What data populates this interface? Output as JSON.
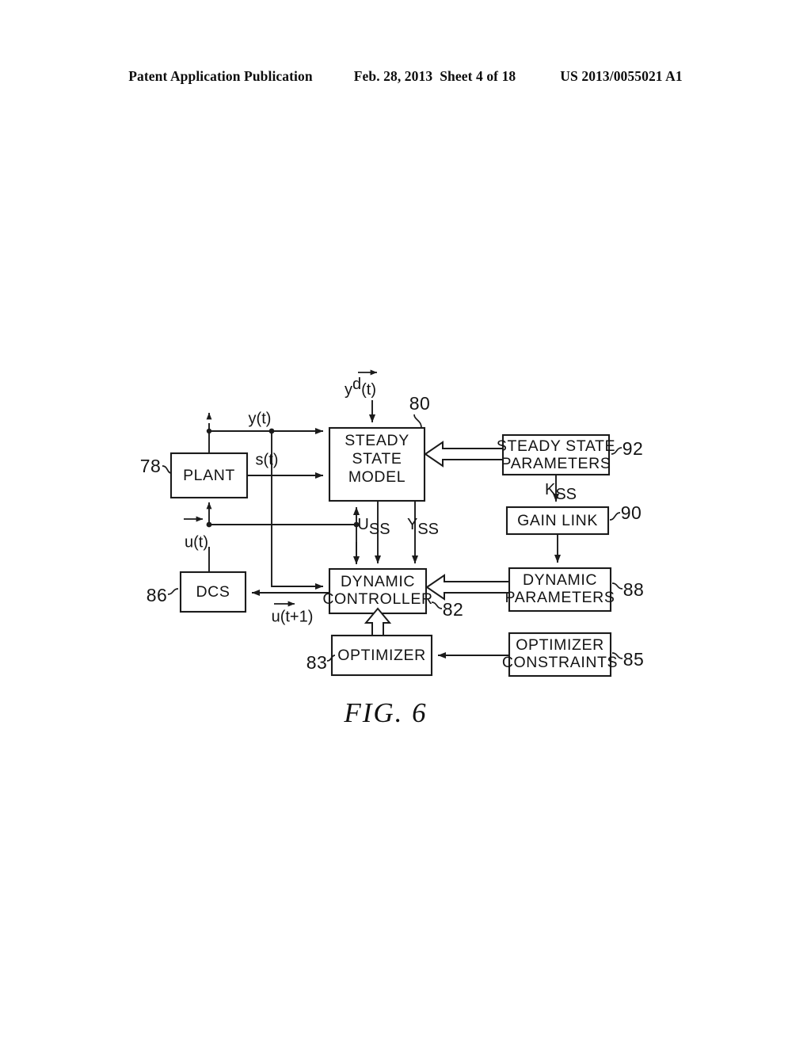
{
  "header": {
    "publication": "Patent Application Publication",
    "date": "Feb. 28, 2013",
    "sheet": "Sheet 4 of 18",
    "patent_number": "US 2013/0055021 A1"
  },
  "figure": {
    "caption": "FIG.  6",
    "blocks": [
      {
        "id": "plant",
        "label": "PLANT",
        "ref": "78"
      },
      {
        "id": "steady-state-model",
        "label_line1": "STEADY",
        "label_line2": "STATE",
        "label_line3": "MODEL",
        "ref": "80"
      },
      {
        "id": "dynamic-controller",
        "label_line1": "DYNAMIC",
        "label_line2": "CONTROLLER",
        "ref": "82"
      },
      {
        "id": "optimizer",
        "label": "OPTIMIZER",
        "ref": "83"
      },
      {
        "id": "optimizer-constraints",
        "label_line1": "OPTIMIZER",
        "label_line2": "CONSTRAINTS",
        "ref": "85"
      },
      {
        "id": "dcs",
        "label": "DCS",
        "ref": "86"
      },
      {
        "id": "dynamic-parameters",
        "label_line1": "DYNAMIC",
        "label_line2": "PARAMETERS",
        "ref": "88"
      },
      {
        "id": "gain-link",
        "label": "GAIN  LINK",
        "ref": "90"
      },
      {
        "id": "steady-state-parameters",
        "label_line1": "STEADY  STATE",
        "label_line2": "PARAMETERS",
        "ref": "92"
      }
    ],
    "signals": {
      "y_desired_base": "y",
      "y_desired_sup": "d",
      "y_desired_tail": "(t)",
      "y_out": "y(t)",
      "s_out": "s(t)",
      "u_in": "u(t)",
      "u_next": "u(t+1)",
      "u_ss_base": "U",
      "u_ss_sub": "SS",
      "y_ss_base": "Y",
      "y_ss_sub": "SS",
      "k_ss_base": "K",
      "k_ss_sub": "SS"
    }
  }
}
